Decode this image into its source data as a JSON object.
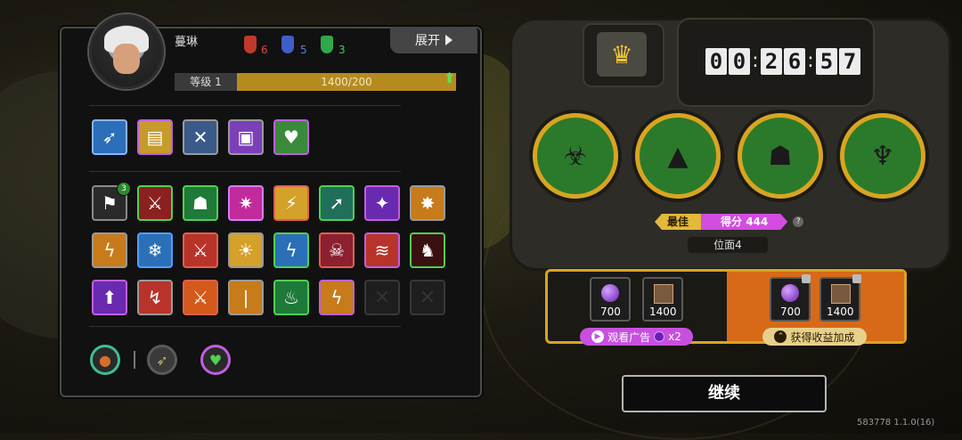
{
  "player": {
    "name": "蔓琳",
    "level_label": "等级 1",
    "level_progress_text": "1400/200",
    "level_progress": 1.0,
    "masks": [
      {
        "color": "#c0392b",
        "count": "6"
      },
      {
        "color": "#3f5ec9",
        "count": "5"
      },
      {
        "color": "#2ea84a",
        "count": "3"
      }
    ]
  },
  "expand_label": "展开",
  "weapon_row": [
    {
      "icon": "crossbow-icon",
      "glyph": "➶",
      "bg": "#2c6fb8",
      "border": "#8ab4ff"
    },
    {
      "icon": "treasure-chest-icon",
      "glyph": "▤",
      "bg": "#c79b2b",
      "border": "#c060e0"
    },
    {
      "icon": "crossed-blades-icon",
      "glyph": "✕",
      "bg": "#3a5a8a",
      "border": "#9a9a9a"
    },
    {
      "icon": "backpack-icon",
      "glyph": "▣",
      "bg": "#7b3fb8",
      "border": "#9a9a9a"
    },
    {
      "icon": "heart-creature-icon",
      "glyph": "♥",
      "bg": "#3b8a3b",
      "border": "#c060e0"
    }
  ],
  "skill_rows": [
    [
      {
        "icon": "flag-shield-icon",
        "glyph": "⚑",
        "bg": "#2a2a2a",
        "border": "#8a8a8a",
        "badge": "3"
      },
      {
        "icon": "split-sword-icon",
        "glyph": "⚔",
        "bg": "#8a2020",
        "border": "#4fd24f"
      },
      {
        "icon": "hooded-figure-icon",
        "glyph": "☗",
        "bg": "#1f7a3a",
        "border": "#4fd24f"
      },
      {
        "icon": "spellbook-icon",
        "glyph": "✷",
        "bg": "#c02a9a",
        "border": "#d77bff"
      },
      {
        "icon": "twin-bolt-icon",
        "glyph": "⚡",
        "bg": "#d4a12b",
        "border": "#e0604f"
      },
      {
        "icon": "green-slash-icon",
        "glyph": "➚",
        "bg": "#1f6f5a",
        "border": "#4fd24f"
      },
      {
        "icon": "purple-claw-icon",
        "glyph": "✦",
        "bg": "#6a2ab0",
        "border": "#c060e0"
      },
      {
        "icon": "explosion-icon",
        "glyph": "✸",
        "bg": "#c77b1b",
        "border": "#9a9a9a"
      }
    ],
    [
      {
        "icon": "lightning-cloud-icon",
        "glyph": "ϟ",
        "bg": "#c77b1b",
        "border": "#9a9a9a"
      },
      {
        "icon": "ice-crack-icon",
        "glyph": "❄",
        "bg": "#2a6fb8",
        "border": "#4fa0ff"
      },
      {
        "icon": "flame-daggers-icon",
        "glyph": "⚔",
        "bg": "#b8342a",
        "border": "#e0604f"
      },
      {
        "icon": "rising-sun-icon",
        "glyph": "☀",
        "bg": "#d4a12b",
        "border": "#9a9a9a"
      },
      {
        "icon": "blue-lightning-icon",
        "glyph": "ϟ",
        "bg": "#2a6fb8",
        "border": "#4fd24f"
      },
      {
        "icon": "skull-mask-icon",
        "glyph": "☠",
        "bg": "#8a2030",
        "border": "#e0604f"
      },
      {
        "icon": "red-stripes-icon",
        "glyph": "≋",
        "bg": "#b8342a",
        "border": "#c060e0"
      },
      {
        "icon": "red-wolf-icon",
        "glyph": "♞",
        "bg": "#3a1010",
        "border": "#4fd24f"
      }
    ],
    [
      {
        "icon": "green-arrow-up-icon",
        "glyph": "⬆",
        "bg": "#6a2ab0",
        "border": "#c060e0"
      },
      {
        "icon": "red-swirl-icon",
        "glyph": "↯",
        "bg": "#b8342a",
        "border": "#9a9a9a"
      },
      {
        "icon": "fire-swords-icon",
        "glyph": "⚔",
        "bg": "#d45a1b",
        "border": "#e0604f"
      },
      {
        "icon": "golden-blades-icon",
        "glyph": "❘",
        "bg": "#c77b1b",
        "border": "#9a9a9a"
      },
      {
        "icon": "green-flame-icon",
        "glyph": "♨",
        "bg": "#1f7a3a",
        "border": "#4fd24f"
      },
      {
        "icon": "thunder-strike-icon",
        "glyph": "ϟ",
        "bg": "#c77b1b",
        "border": "#c060e0"
      },
      {
        "icon": "empty-slot-icon",
        "glyph": "✕",
        "empty": true
      },
      {
        "icon": "empty-slot-icon",
        "glyph": "✕",
        "empty": true
      }
    ]
  ],
  "bottom_icons": [
    {
      "icon": "tortoise-shell-icon",
      "glyph": "●",
      "bg": "#2a2a2a",
      "border": "#3fbf8f",
      "color": "#d4702b"
    },
    {
      "icon": "crossbow-mini-icon",
      "glyph": "➶",
      "bg": "#3a3a3a",
      "border": "#5a5a5a",
      "color": "#c9b27a"
    },
    {
      "icon": "green-heart-icon",
      "glyph": "♥",
      "bg": "#2a2a2a",
      "border": "#c060e0",
      "color": "#4fd24f"
    }
  ],
  "timer": {
    "digits": [
      "0",
      "0",
      "2",
      "6",
      "5",
      "7"
    ]
  },
  "bosses": [
    {
      "icon": "red-eyed-insect-boss-icon",
      "glyph": "☣"
    },
    {
      "icon": "purple-horned-boss-icon",
      "glyph": "▲"
    },
    {
      "icon": "armored-helmet-boss-icon",
      "glyph": "☗"
    },
    {
      "icon": "fanged-demon-boss-icon",
      "glyph": "♆"
    }
  ],
  "best_label": "最佳",
  "score_label": "得分 444",
  "position_label": "位面4",
  "rewards": {
    "ad_orbs": "700",
    "ad_cards": "1400",
    "boost_orbs": "700",
    "boost_cards": "1400",
    "watch_ad_label": "观看广告",
    "watch_ad_multiplier": "x2",
    "boost_label": "获得收益加成"
  },
  "continue_label": "继续",
  "version": "583778 1.1.0(16)"
}
